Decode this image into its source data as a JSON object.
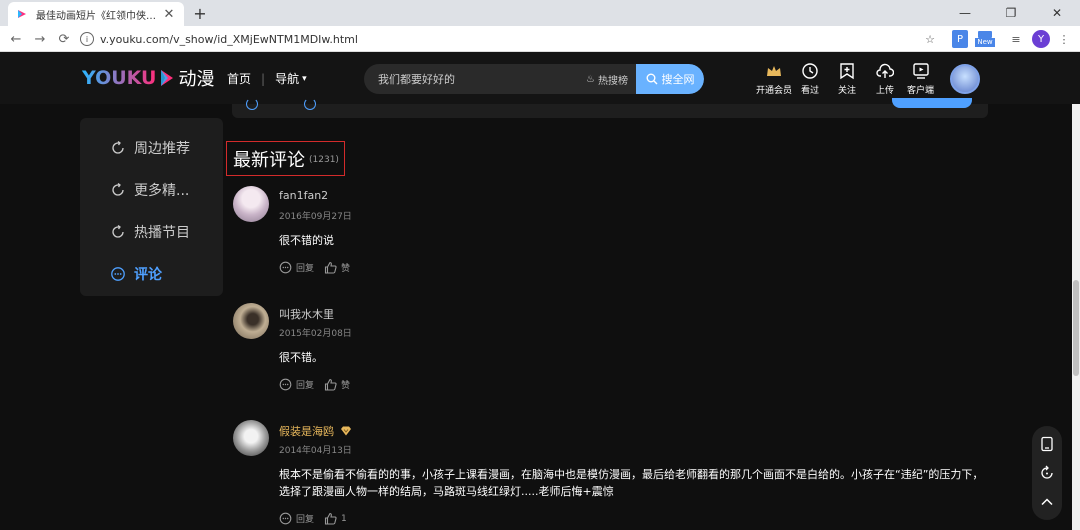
{
  "browser": {
    "tab_title": "最佳动画短片《红领巾侠》 -",
    "url": "v.youku.com/v_show/id_XMjEwNTM1MDIw.html",
    "profile_initial": "Y",
    "ext_new_label": "New"
  },
  "header": {
    "logo_text": "YOUKU",
    "logo_suffix": "动漫",
    "nav_home": "首页",
    "nav_guide": "导航",
    "search_placeholder": "我们都要好好的",
    "hot_label": "热搜榜",
    "search_button": "搜全网",
    "icons": [
      {
        "label": "开通会员",
        "icon": "crown-icon"
      },
      {
        "label": "看过",
        "icon": "clock-icon"
      },
      {
        "label": "关注",
        "icon": "bookmark-plus-icon"
      },
      {
        "label": "上传",
        "icon": "upload-cloud-icon"
      },
      {
        "label": "客户端",
        "icon": "play-screen-icon"
      }
    ]
  },
  "sidebar": {
    "items": [
      {
        "label": "周边推荐",
        "active": false
      },
      {
        "label": "更多精...",
        "active": false
      },
      {
        "label": "热播节目",
        "active": false
      },
      {
        "label": "评论",
        "active": true
      }
    ]
  },
  "comments": {
    "title": "最新评论",
    "count": "(1231)",
    "reply_label": "回复",
    "like_label": "赞",
    "items": [
      {
        "name": "fan1fan2",
        "date": "2016年09月27日",
        "text": "很不错的说",
        "like": "赞"
      },
      {
        "name": "叫我水木里",
        "date": "2015年02月08日",
        "text": "很不错。",
        "like": "赞"
      },
      {
        "name": "假装是海鸥",
        "date": "2014年04月13日",
        "text": "根本不是偷看不偷看的的事，小孩子上课看漫画，在脑海中也是模仿漫画，最后给老师翻看的那几个画面不是白给的。小孩子在“违纪”的压力下，选择了跟漫画人物一样的结局，马路斑马线红绿灯.....老师后悔+震惊",
        "like": "1"
      }
    ]
  },
  "colors": {
    "accent": "#69b2ff",
    "active_blue": "#4fa0ff",
    "highlight_red": "#d32b2b",
    "vip_gold": "#e8b85c"
  }
}
